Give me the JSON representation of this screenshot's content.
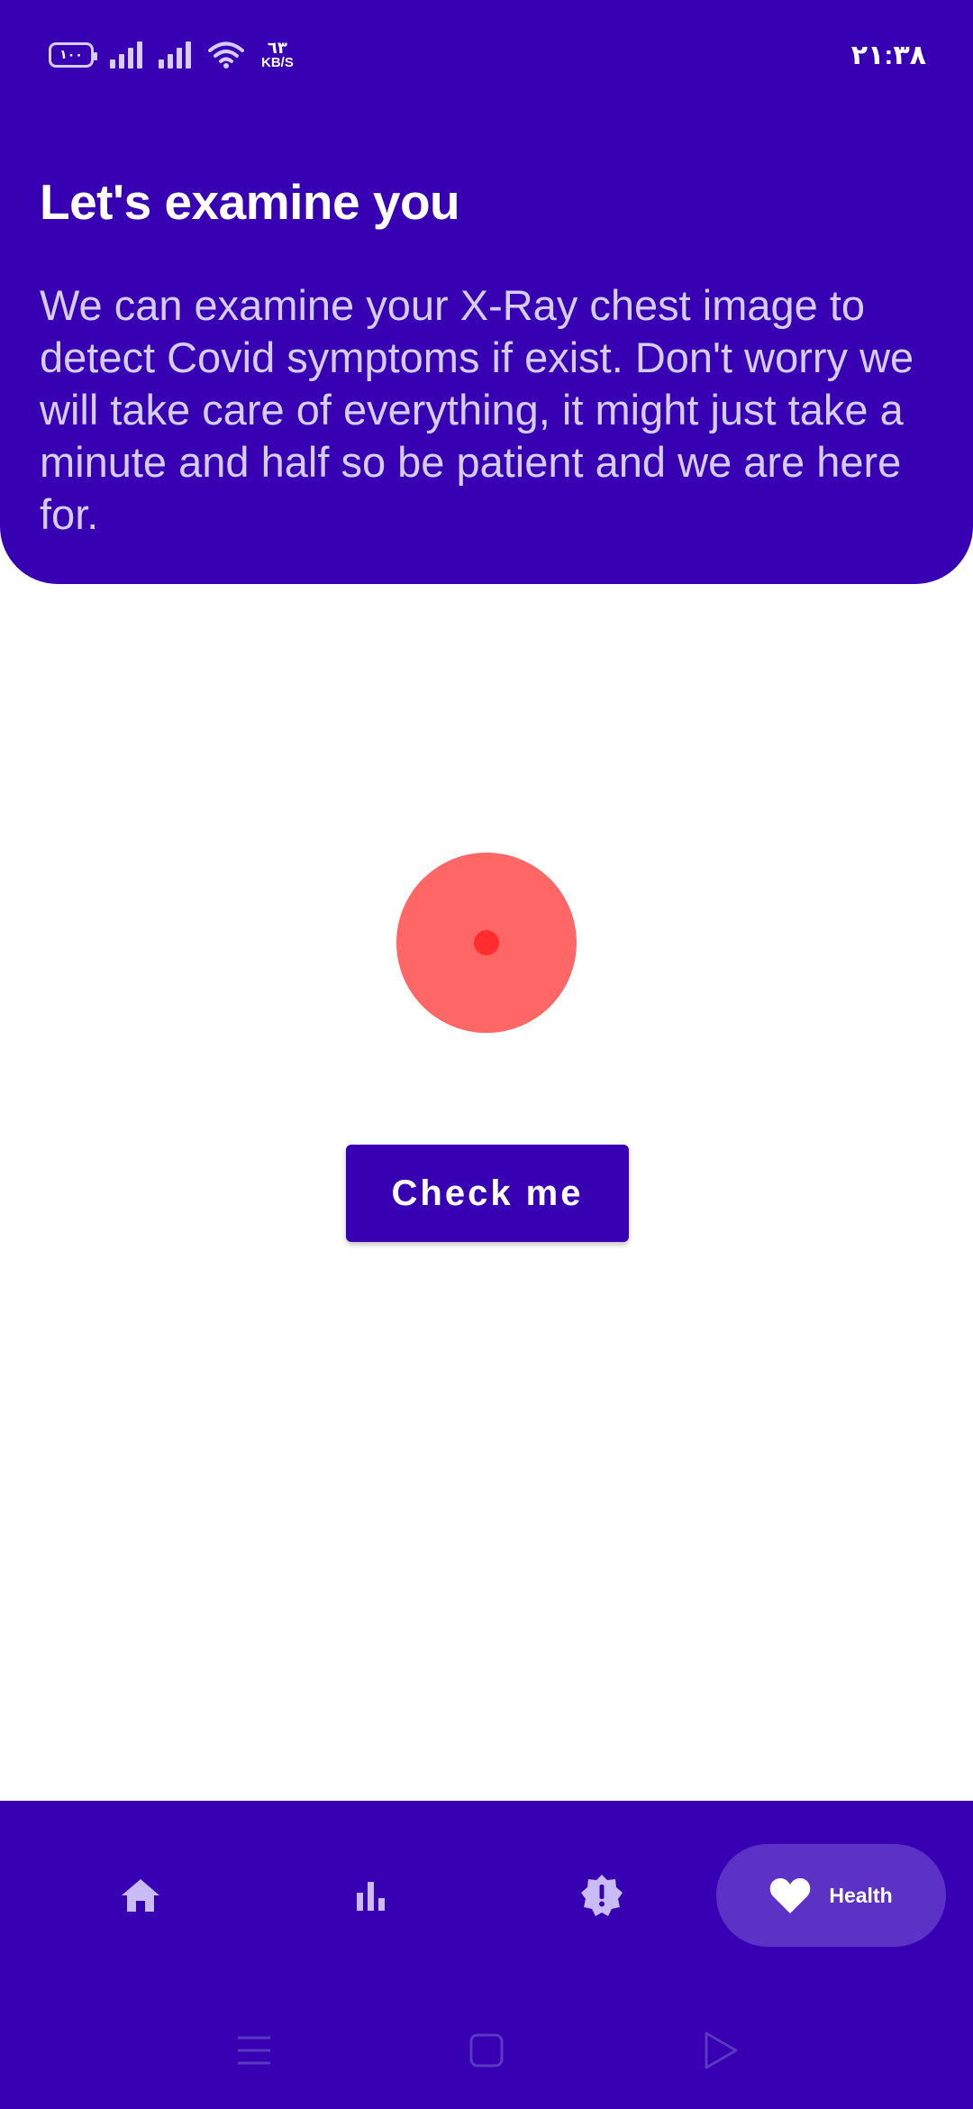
{
  "status_bar": {
    "battery_level": "١٠٠",
    "network_speed_value": "٦٣",
    "network_speed_unit": "KB/S",
    "time": "٢١:٣٨"
  },
  "header": {
    "title": "Let's examine you",
    "description": "We can examine your X-Ray chest image to detect Covid symptoms if exist. Don't worry we will take care of everything, it might just take a minute and half so be patient and we are here for."
  },
  "main": {
    "check_button_label": "Check me"
  },
  "bottom_nav": {
    "items": [
      {
        "icon": "home-icon",
        "label": ""
      },
      {
        "icon": "bar-chart-icon",
        "label": ""
      },
      {
        "icon": "alert-badge-icon",
        "label": ""
      },
      {
        "icon": "heart-icon",
        "label": "Health"
      }
    ],
    "active_index": 3
  },
  "colors": {
    "primary": "#3700b3",
    "accent_red": "#ff6666",
    "pulse_dot": "#ff2d2d",
    "active_pill": "#5c32c6"
  }
}
